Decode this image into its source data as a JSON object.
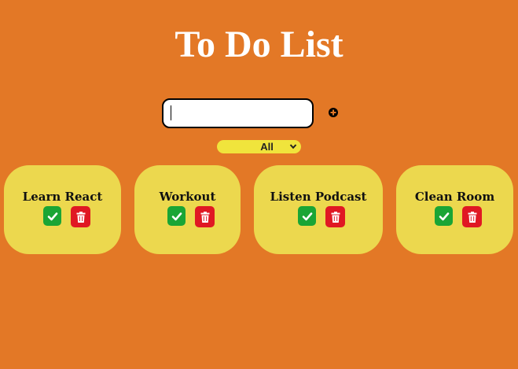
{
  "header": {
    "title": "To Do List"
  },
  "form": {
    "input_value": "",
    "add_icon": "plus-circle-icon",
    "filter_selected": "All"
  },
  "colors": {
    "background": "#e37826",
    "card": "#ecd84e",
    "complete": "#1aa535",
    "delete": "#e01823",
    "filter": "#f0e43c"
  },
  "todos": [
    {
      "text": "Learn React",
      "complete_icon": "check-icon",
      "delete_icon": "trash-icon"
    },
    {
      "text": "Workout",
      "complete_icon": "check-icon",
      "delete_icon": "trash-icon"
    },
    {
      "text": "Listen Podcast",
      "complete_icon": "check-icon",
      "delete_icon": "trash-icon"
    },
    {
      "text": "Clean Room",
      "complete_icon": "check-icon",
      "delete_icon": "trash-icon"
    }
  ]
}
